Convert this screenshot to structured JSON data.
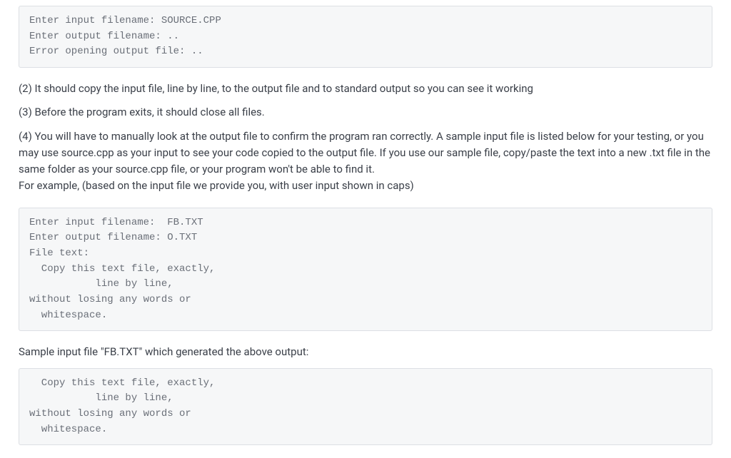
{
  "codeblock_1": "Enter input filename: SOURCE.CPP\nEnter output filename: ..\nError opening output file: ..",
  "para_2": "(2) It should copy the input file, line by line, to the output file and to standard output so you can see it working",
  "para_3": "(3) Before the program exits, it should close all files.",
  "para_4a": "(4) You will have to manually look at the output file to confirm the program ran correctly. A sample input file is listed below for your testing, or you may use source.cpp as your input to see your code copied to the output file. If you use our sample file, copy/paste the text into a new .txt file in the same folder as your source.cpp file, or your program won't be able to find it.",
  "para_4b": "For example, (based on the input file we provide you, with user input shown in caps)",
  "codeblock_2": "Enter input filename:  FB.TXT\nEnter output filename: O.TXT\nFile text:\n  Copy this text file, exactly,\n           line by line,\nwithout losing any words or\n  whitespace.",
  "para_5": "Sample input file \"FB.TXT\" which generated the above output:",
  "codeblock_3": "  Copy this text file, exactly,\n           line by line,\nwithout losing any words or\n  whitespace."
}
